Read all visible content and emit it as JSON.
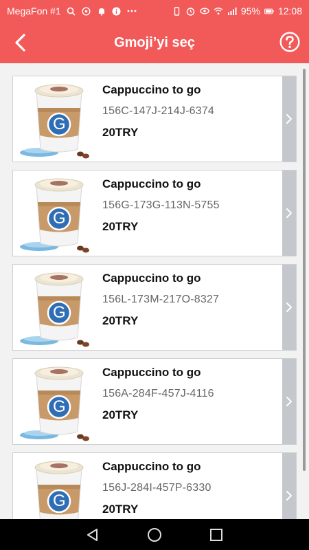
{
  "status_bar": {
    "carrier": "MegaFon #1",
    "battery": "95%",
    "time": "12:08"
  },
  "header": {
    "title": "Gmoji’yi seç"
  },
  "colors": {
    "accent": "#f25a5a",
    "chevron_strip": "#c4c8cc"
  },
  "items": [
    {
      "name": "Cappuccino to go",
      "code": "156C-147J-214J-6374",
      "price": "20TRY",
      "badge": "G"
    },
    {
      "name": "Cappuccino to go",
      "code": "156G-173G-113N-5755",
      "price": "20TRY",
      "badge": "G"
    },
    {
      "name": "Cappuccino to go",
      "code": "156L-173M-217O-8327",
      "price": "20TRY",
      "badge": "G"
    },
    {
      "name": "Cappuccino to go",
      "code": "156A-284F-457J-4116",
      "price": "20TRY",
      "badge": "G"
    },
    {
      "name": "Cappuccino to go",
      "code": "156J-284I-457P-6330",
      "price": "20TRY",
      "badge": "G"
    }
  ]
}
